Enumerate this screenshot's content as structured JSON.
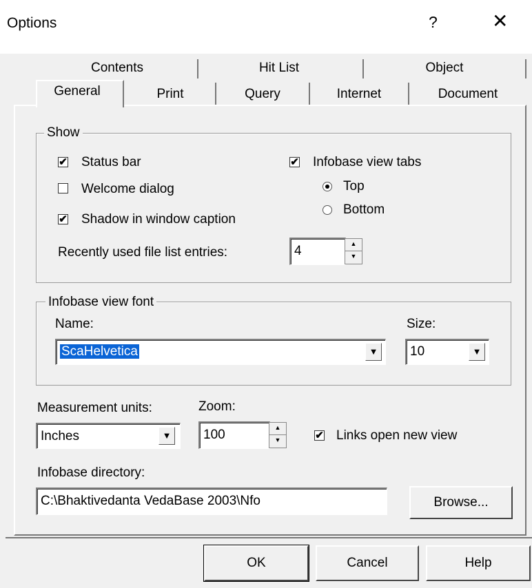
{
  "window": {
    "title": "Options",
    "help_glyph": "?",
    "close_glyph": "✕"
  },
  "tabs": {
    "row_back": [
      "Contents",
      "Hit List",
      "Object"
    ],
    "row_front": [
      "General",
      "Print",
      "Query",
      "Internet",
      "Document"
    ],
    "active": "General"
  },
  "show_group": {
    "title": "Show",
    "status_bar": {
      "label": "Status bar",
      "checked": true
    },
    "welcome_dialog": {
      "label": "Welcome dialog",
      "checked": false
    },
    "shadow_caption": {
      "label": "Shadow in window caption",
      "checked": true
    },
    "view_tabs": {
      "label": "Infobase view tabs",
      "checked": true
    },
    "radio_top": {
      "label": "Top",
      "selected": true
    },
    "radio_bottom": {
      "label": "Bottom",
      "selected": false
    },
    "recent_label": "Recently used file list entries:",
    "recent_value": "4"
  },
  "font_group": {
    "title": "Infobase view font",
    "name_label": "Name:",
    "name_value": "ScaHelvetica",
    "size_label": "Size:",
    "size_value": "10"
  },
  "measurement": {
    "label": "Measurement units:",
    "value": "Inches"
  },
  "zoom": {
    "label": "Zoom:",
    "value": "100"
  },
  "links": {
    "label": "Links open new view",
    "checked": true
  },
  "directory": {
    "label": "Infobase directory:",
    "value": "C:\\Bhaktivedanta VedaBase 2003\\Nfo",
    "browse": "Browse..."
  },
  "footer": {
    "ok": "OK",
    "cancel": "Cancel",
    "help": "Help"
  },
  "glyphs": {
    "check": "✔",
    "dropdown": "▼",
    "spin_up": "▲",
    "spin_down": "▼"
  }
}
